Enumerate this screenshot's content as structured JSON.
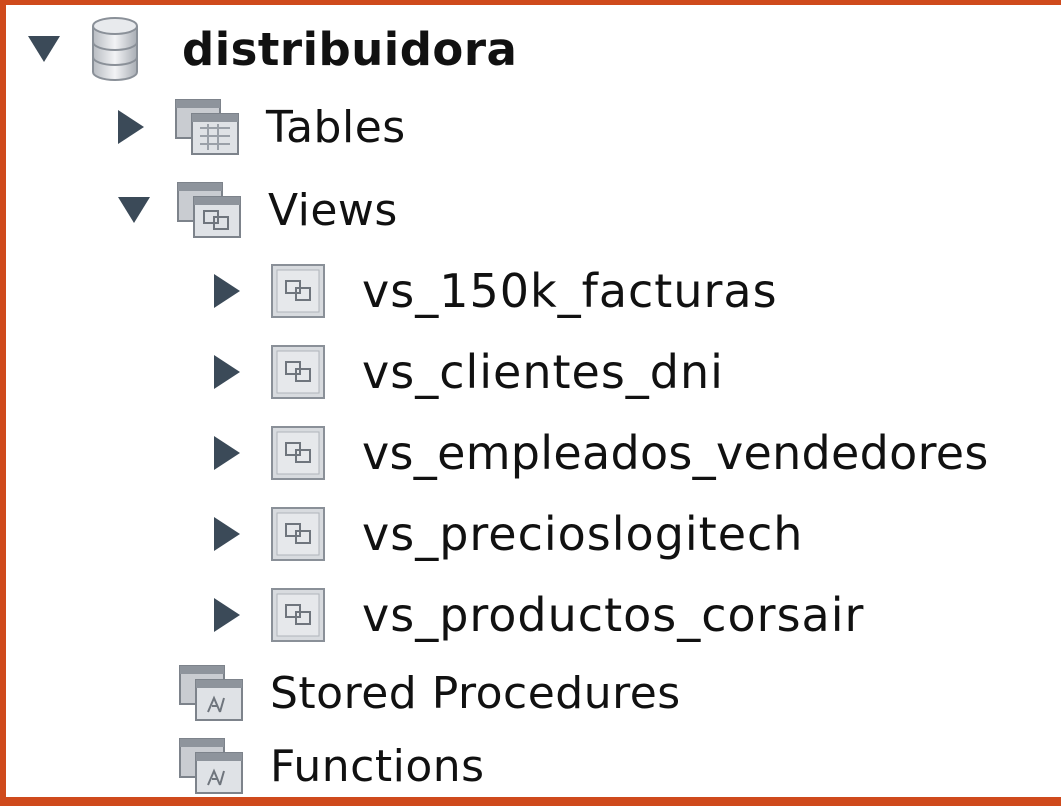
{
  "tree": {
    "schema": {
      "label": "distribuidora",
      "icon": "database-icon",
      "expanded": true
    },
    "tables": {
      "label": "Tables",
      "icon": "tables-folder-icon",
      "expanded": false
    },
    "views": {
      "label": "Views",
      "icon": "views-folder-icon",
      "expanded": true,
      "items": [
        {
          "label": "vs_150k_facturas",
          "icon": "view-icon"
        },
        {
          "label": "vs_clientes_dni",
          "icon": "view-icon"
        },
        {
          "label": "vs_empleados_vendedores",
          "icon": "view-icon"
        },
        {
          "label": "vs_precioslogitech",
          "icon": "view-icon"
        },
        {
          "label": "vs_productos_corsair",
          "icon": "view-icon"
        }
      ]
    },
    "stored_procedures": {
      "label": "Stored Procedures",
      "icon": "procedures-folder-icon"
    },
    "functions": {
      "label": "Functions",
      "icon": "functions-folder-icon"
    }
  },
  "colors": {
    "background_frame": "#cf4a1c",
    "arrow": "#3b4a58",
    "icon_border": "#8a9098"
  }
}
